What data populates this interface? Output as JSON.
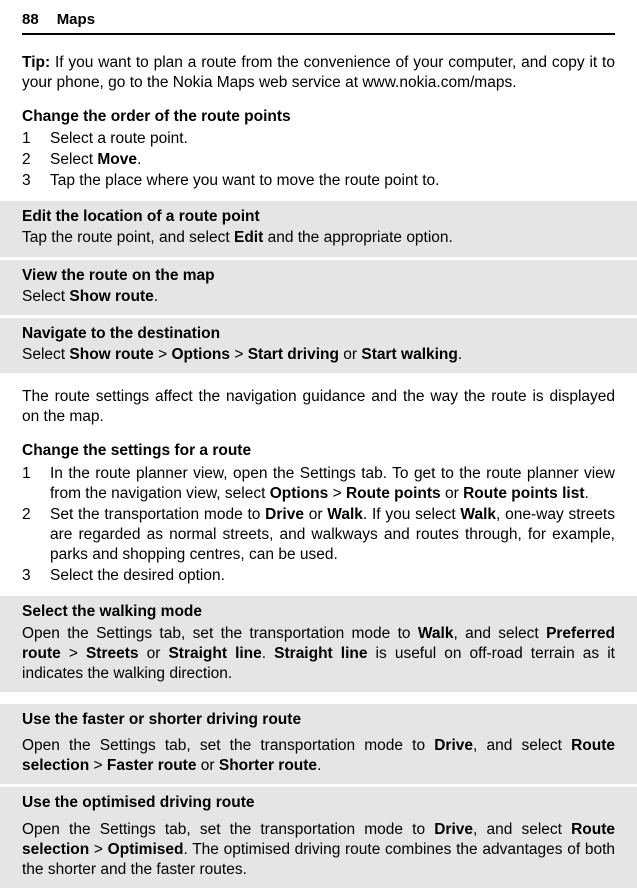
{
  "header": {
    "page": "88",
    "title": "Maps"
  },
  "tip": {
    "label": "Tip:",
    "text": " If you want to plan a route from the convenience of your computer, and copy it to your phone, go to the Nokia Maps web service at www.nokia.com/maps."
  },
  "changeOrder": {
    "title": "Change the order of the route points",
    "s1_n": "1",
    "s1_t": "Select a route point.",
    "s2_n": "2",
    "s2_ta": "Select ",
    "s2_move": "Move",
    "s2_tc": ".",
    "s3_n": "3",
    "s3_t": "Tap the place where you want to move the route point to."
  },
  "editLoc": {
    "title": "Edit the location of a route point",
    "ta": "Tap the route point, and select ",
    "edit": "Edit",
    "tb": " and the appropriate option."
  },
  "viewMap": {
    "title": "View the route on the map",
    "ta": "Select ",
    "show": "Show route",
    "tb": "."
  },
  "navigate": {
    "title": "Navigate to the destination",
    "ta": "Select ",
    "show": "Show route",
    "gt1": "  >  ",
    "options": "Options",
    "gt2": "  >  ",
    "startd": "Start driving",
    "or": " or ",
    "startw": "Start walking",
    "tb": "."
  },
  "affect": "The route settings affect the navigation guidance and the way the route is displayed on the map.",
  "changeSettings": {
    "title": "Change the settings for a route",
    "s1_n": "1",
    "s1_a": "In the route planner view, open the Settings tab. To get to the route planner view from the navigation view, select ",
    "s1_options": "Options",
    "s1_gt": "  >  ",
    "s1_rp": "Route points",
    "s1_or": " or ",
    "s1_rpl": "Route points list",
    "s1_b": ".",
    "s2_n": "2",
    "s2_a": "Set the transportation mode to ",
    "s2_drive": "Drive",
    "s2_or1": " or ",
    "s2_walk": "Walk",
    "s2_b": ". If you select ",
    "s2_walk2": "Walk",
    "s2_c": ", one-way streets are regarded as normal streets, and walkways and routes through, for example, parks and shopping centres, can be used.",
    "s3_n": "3",
    "s3_t": "Select the desired option."
  },
  "walkingMode": {
    "title": "Select the walking mode",
    "a": "Open the Settings tab, set the transportation mode to ",
    "walk": "Walk",
    "b": ", and select ",
    "pref": "Preferred route",
    "gt": "  >  ",
    "streets": "Streets",
    "or": " or ",
    "sline": "Straight line",
    "c": ". ",
    "sline2": "Straight line",
    "d": " is useful on off-road terrain as it indicates the walking direction."
  },
  "faster": {
    "title": "Use the faster or shorter driving route",
    "a": "Open the Settings tab, set the transportation mode to ",
    "drive": "Drive",
    "b": ", and select ",
    "rs": "Route selection",
    "gt": "  >  ",
    "fr": "Faster route",
    "or": " or ",
    "sr": "Shorter route",
    "c": "."
  },
  "optimised": {
    "title": "Use the optimised driving route",
    "a": "Open the Settings tab, set the transportation mode to ",
    "drive": "Drive",
    "b": ", and select ",
    "rs": "Route selection",
    "gt": "  >  ",
    "opt": "Optimised",
    "c": ". The optimised driving route combines the advantages of both the shorter and the faster routes."
  }
}
